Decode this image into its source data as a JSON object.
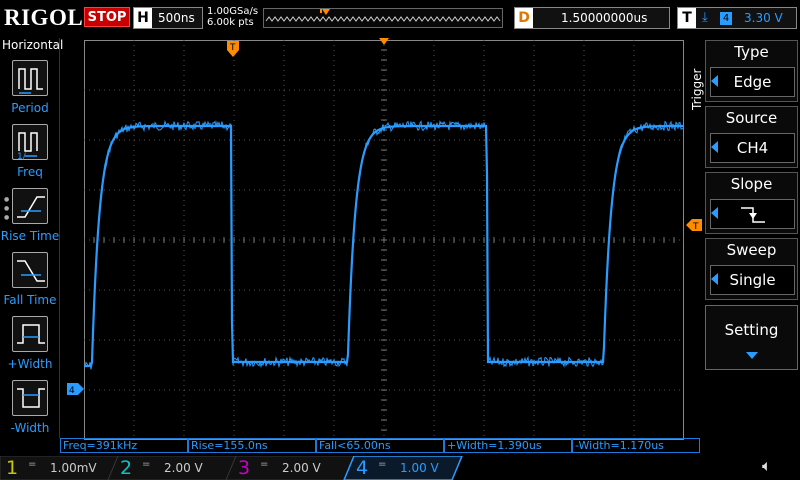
{
  "header": {
    "logo": "RIGOL",
    "run_state": "STOP",
    "timebase_label": "H",
    "timebase_value": "500ns",
    "sample_rate": "1.00GSa/s",
    "memory_depth": "6.00k pts",
    "delay_label": "D",
    "delay_value": "1.50000000us",
    "trigger_label": "T",
    "trigger_channel": "4",
    "trigger_level": "3.30 V"
  },
  "left_menu": {
    "title": "Horizontal",
    "items": [
      {
        "label": "Period",
        "icon": "period-icon"
      },
      {
        "label": "Freq",
        "icon": "freq-icon"
      },
      {
        "label": "Rise Time",
        "icon": "rise-time-icon"
      },
      {
        "label": "Fall Time",
        "icon": "fall-time-icon"
      },
      {
        "label": "+Width",
        "icon": "pos-width-icon"
      },
      {
        "label": "-Width",
        "icon": "neg-width-icon"
      }
    ]
  },
  "right_menu": {
    "section_title": "Trigger",
    "type_title": "Type",
    "type_value": "Edge",
    "source_title": "Source",
    "source_value": "CH4",
    "slope_title": "Slope",
    "slope_icon": "falling-edge-icon",
    "sweep_title": "Sweep",
    "sweep_value": "Single",
    "setting_title": "Setting"
  },
  "measurements": [
    "Freq=391kHz",
    "Rise=155.0ns",
    "Fall<65.00ns",
    "+Width=1.390us",
    "-Width=1.170us"
  ],
  "channels": [
    {
      "num": "1",
      "coupling": "=",
      "scale": "1.00mV",
      "color": "#c8c800"
    },
    {
      "num": "2",
      "coupling": "=",
      "scale": "2.00 V",
      "color": "#00c8c8"
    },
    {
      "num": "3",
      "coupling": "=",
      "scale": "2.00 V",
      "color": "#c800c8"
    },
    {
      "num": "4",
      "coupling": "=",
      "scale": "1.00 V",
      "color": "#2a9cff"
    }
  ],
  "colors": {
    "trace": "#2a9cff",
    "trigger_marker": "#ff8c00",
    "grid": "#555555",
    "stop": "#c80000"
  },
  "waveform": {
    "channel": "4",
    "time_per_div_ns": 500,
    "volts_per_div": 1.0,
    "high_level_v": 2.0,
    "low_level_v": -1.7,
    "first_rising_edge_ns": 0
  }
}
